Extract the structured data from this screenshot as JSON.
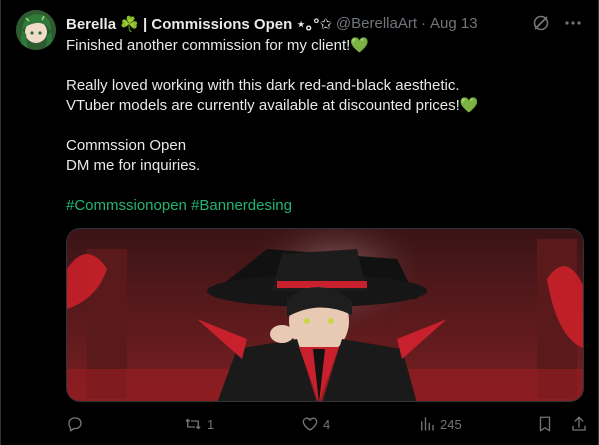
{
  "author": {
    "display_name": "Berella ☘️ | Commissions Open ⋆｡°✩",
    "handle": "@BerellaArt",
    "separator": "·",
    "date": "Aug 13"
  },
  "post": {
    "line1": "Finished another commission for my client!💚",
    "line2": "Really loved working with this dark red-and-black aesthetic.",
    "line3": "VTuber models are currently available at discounted prices!💚",
    "line4": "Commssion Open",
    "line5": "DM me for inquiries.",
    "hashtag1": "#Commssionopen",
    "hashtag2": "#Bannerdesing"
  },
  "actions": {
    "reply_count": "",
    "repost_count": "1",
    "like_count": "4",
    "views_count": "245"
  },
  "icons": [
    "avatar",
    "grok-icon",
    "more-icon",
    "reply-icon",
    "repost-icon",
    "like-icon",
    "views-icon",
    "bookmark-icon",
    "share-icon"
  ],
  "colors": {
    "background": "#000000",
    "text": "#e7e9ea",
    "muted": "#71767b",
    "hashtag": "#21b573"
  }
}
